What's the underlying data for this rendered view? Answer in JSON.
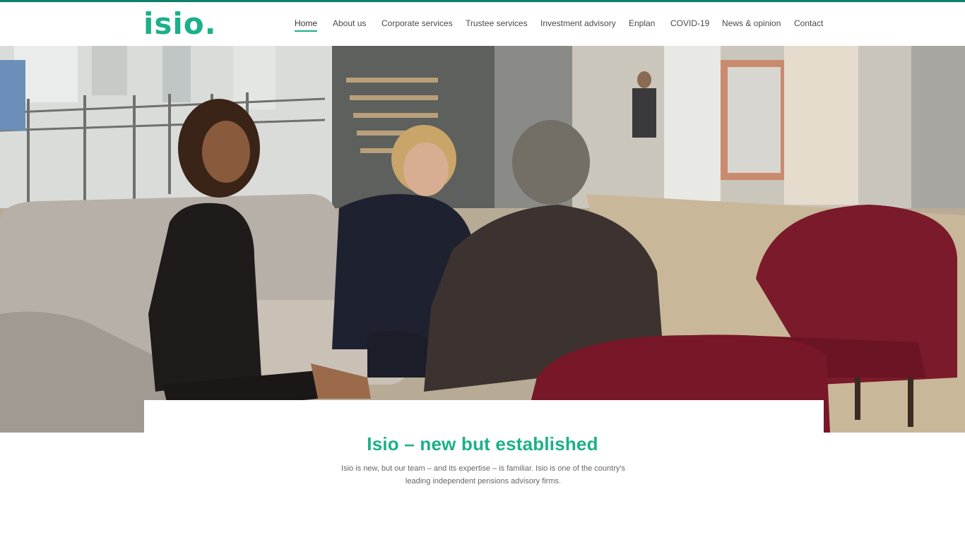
{
  "brand": {
    "logo_text": "isio.",
    "accent_color": "#1bb08a",
    "strip_color": "#0e7f6b"
  },
  "nav": {
    "items": [
      {
        "label": "Home",
        "active": true
      },
      {
        "label": "About us"
      },
      {
        "label": "Corporate services"
      },
      {
        "label": "Trustee services"
      },
      {
        "label": "Investment advisory"
      },
      {
        "label": "Enplan"
      },
      {
        "label": "COVID-19"
      },
      {
        "label": "News & opinion"
      },
      {
        "label": "Contact"
      }
    ]
  },
  "hero": {
    "image_subject": "office-meeting-photo"
  },
  "intro": {
    "headline": "Isio – new but established",
    "body": "Isio is new, but our team – and its expertise – is familiar. Isio is one of the country's leading independent pensions advisory firms."
  }
}
